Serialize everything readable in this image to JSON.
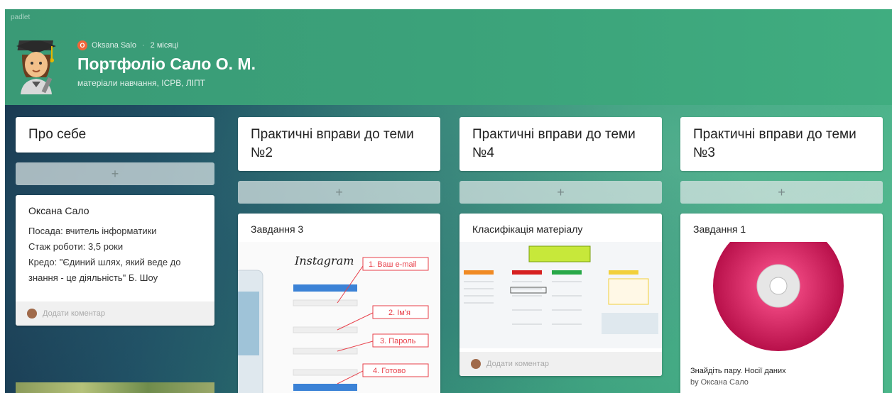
{
  "app": {
    "brand": "padlet"
  },
  "header": {
    "author": "Oksana Salo",
    "author_initial": "O",
    "time_ago": "2 місяці",
    "title": "Портфоліо Сало О. М.",
    "subtitle": "матеріали навчання, ІСРВ, ЛІПТ"
  },
  "columns": [
    {
      "title": "Про себе",
      "add_label": "+",
      "card": {
        "title": "Оксана Сало",
        "lines": [
          "Посада: вчитель інформатики",
          "Стаж роботи: 3,5 роки",
          "Кредо: \"Єдиний шлях, який веде до знання - це діяльність\" Б. Шоу"
        ],
        "comment_placeholder": "Додати коментар"
      }
    },
    {
      "title": "Практичні вправи до теми №2",
      "add_label": "+",
      "card": {
        "title": "Завдання 3",
        "instagram": "Instagram",
        "steps": [
          "1. Ваш e-mail",
          "2. Ім'я",
          "3. Пароль",
          "4. Готово"
        ]
      }
    },
    {
      "title": "Практичні вправи до теми №4",
      "add_label": "+",
      "card": {
        "title": "Класифікація матеріалу",
        "comment_placeholder": "Додати коментар"
      }
    },
    {
      "title": "Практичні вправи до теми №3",
      "add_label": "+",
      "card": {
        "title": "Завдання 1",
        "caption": "Знайдіть пару. Носії даних",
        "byline": "by Оксана Сало"
      }
    }
  ],
  "colors": {
    "header_green": "#3ba27a",
    "avatar_badge": "#f0663a",
    "step_red": "#e8404a"
  }
}
